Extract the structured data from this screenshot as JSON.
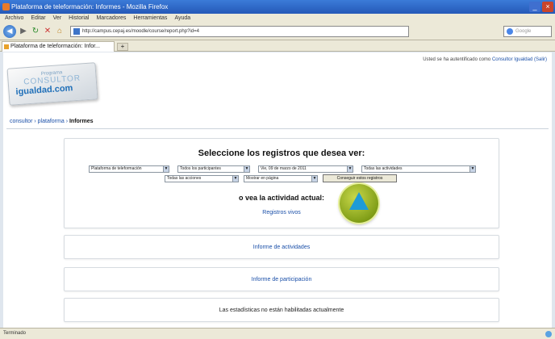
{
  "window": {
    "title": "Plataforma de teleformación: Informes - Mozilla Firefox",
    "minimize": "_",
    "close": "×"
  },
  "menu": [
    "Archivo",
    "Editar",
    "Ver",
    "Historial",
    "Marcadores",
    "Herramientas",
    "Ayuda"
  ],
  "nav": {
    "url": "http://campus.cepaj.es/moodle/course/report.php?id=4",
    "search_placeholder": "Google"
  },
  "tab": {
    "label": "Plataforma de teleformación: Infor...",
    "new_tab": "+"
  },
  "header": {
    "login_prefix": "Usted se ha autentificado como",
    "login_user": "Consultor Igualdad",
    "logout": "(Salir)"
  },
  "logo": {
    "line1": "Programa",
    "line2": "CONSULTOR",
    "line3": "igualdad.com"
  },
  "breadcrumb": {
    "items": [
      "consultor",
      "plataforma"
    ],
    "separator": "›",
    "current": "Informes"
  },
  "logs_panel": {
    "title": "Seleccione los registros que desea ver:",
    "row1": {
      "course": "Plataforma de teleformación",
      "participants": "Todos los participantes",
      "date": "Vie, 09 de marzo de 2011",
      "activities": "Todas las actividades"
    },
    "row2": {
      "actions": "Todas las acciones",
      "display": "Mostrar en página",
      "submit": "Conseguir estos registros"
    },
    "or_text": "o vea la actividad actual:",
    "recent_link": "Registros vivos"
  },
  "reports": {
    "activity": "Informe de actividades",
    "participation": "Informe de participación",
    "stats": "Las estadísticas no están habilitadas actualmente"
  },
  "status": {
    "text": "Terminado"
  },
  "accent": {
    "link": "#1a4fa8",
    "marker": "#8fae1c",
    "marker_arrow": "#1e9bd6"
  }
}
